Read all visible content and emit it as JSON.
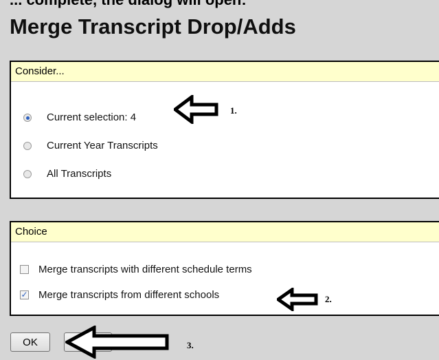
{
  "top_partial_text": "... complete, the dialog will open:",
  "dialog": {
    "title": "Merge Transcript Drop/Adds",
    "consider": {
      "header": "Consider...",
      "options": [
        {
          "label": "Current selection: 4",
          "selected": true
        },
        {
          "label": "Current Year Transcripts",
          "selected": false
        },
        {
          "label": "All Transcripts",
          "selected": false
        }
      ]
    },
    "choice": {
      "header": "Choice",
      "options": [
        {
          "label": "Merge transcripts with different schedule terms",
          "checked": false
        },
        {
          "label": "Merge transcripts from different schools",
          "checked": true
        }
      ]
    },
    "buttons": {
      "ok": "OK",
      "cancel": ""
    }
  },
  "annotations": {
    "step1": "1.",
    "step2": "2.",
    "step3": "3."
  },
  "colors": {
    "panel_header_bg": "#ffffcc",
    "background": "#d6d6d6",
    "accent": "#2b5fbf"
  }
}
